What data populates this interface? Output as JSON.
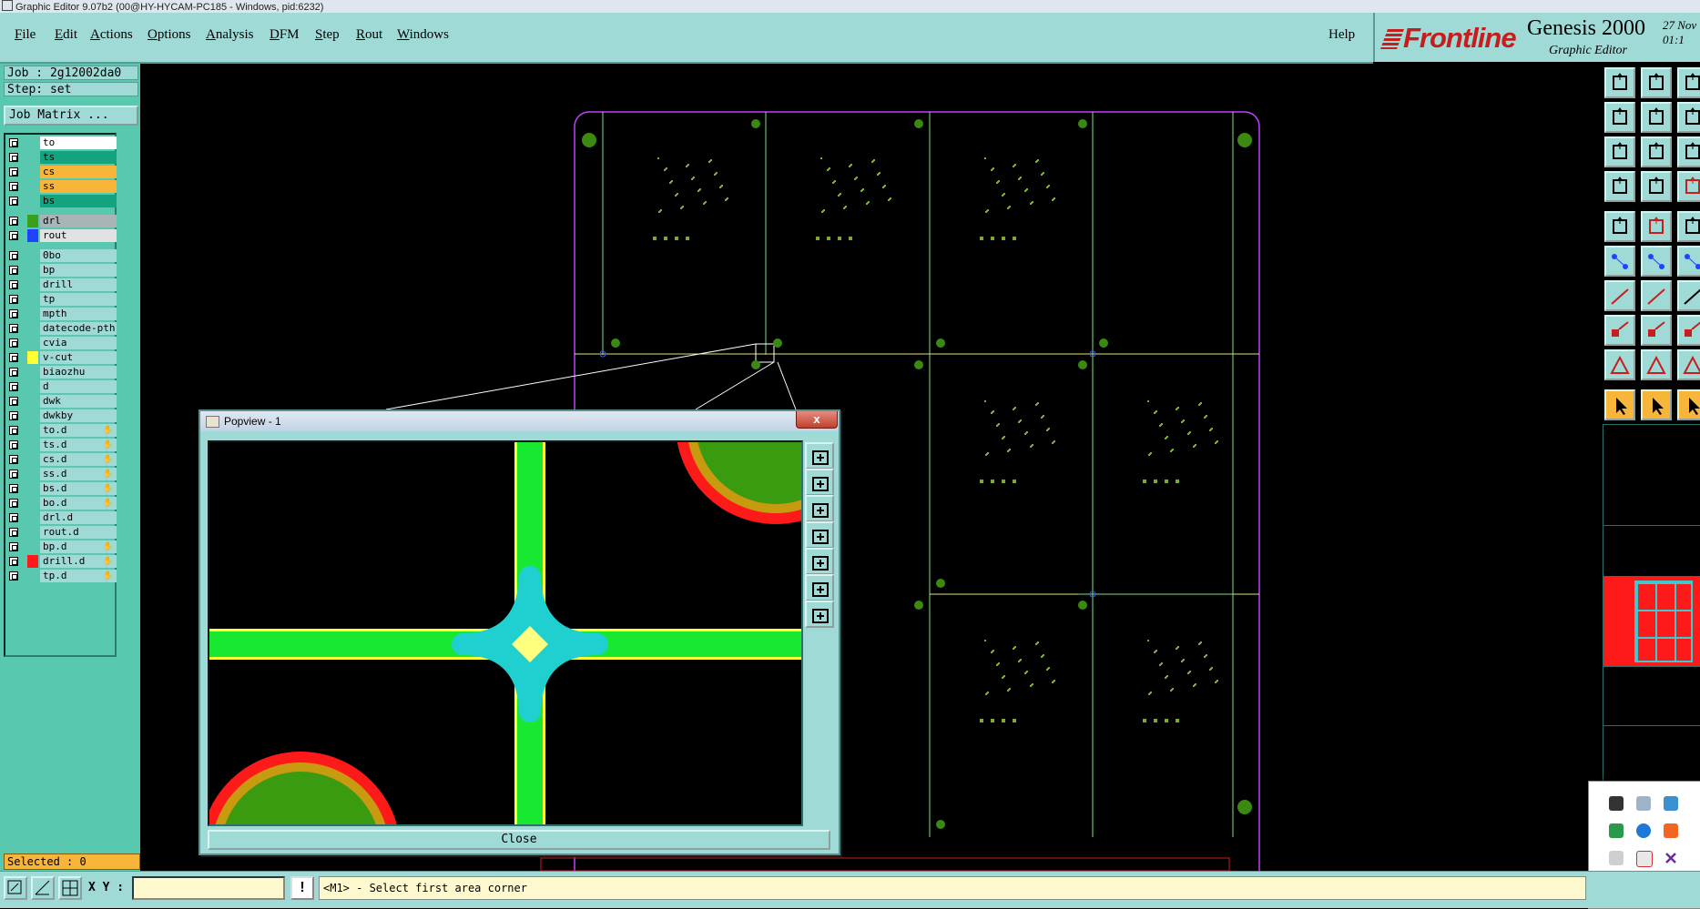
{
  "window": {
    "title": "Graphic Editor 9.07b2 (00@HY-HYCAM-PC185 - Windows, pid:6232)"
  },
  "menubar": {
    "items": [
      {
        "u": "F",
        "rest": "ile"
      },
      {
        "u": "E",
        "rest": "dit"
      },
      {
        "u": "A",
        "rest": "ctions"
      },
      {
        "u": "O",
        "rest": "ptions"
      },
      {
        "u": "A",
        "rest": "nalysis"
      },
      {
        "u": "D",
        "rest": "FM"
      },
      {
        "u": "S",
        "rest": "tep"
      },
      {
        "u": "R",
        "rest": "out"
      },
      {
        "u": "W",
        "rest": "indows"
      }
    ],
    "help": "Help"
  },
  "brand": {
    "logo": "Frontline",
    "product": "Genesis 2000",
    "subtitle": "Graphic Editor",
    "date_line1": "27 Nov",
    "date_line2": "01:1"
  },
  "job": {
    "job_label": "Job : 2g12002da0",
    "step_label": "Step: set",
    "job_matrix": "Job Matrix ..."
  },
  "layers": [
    {
      "name": "to",
      "color": "#ffffff",
      "swatch": "",
      "hand": false
    },
    {
      "name": "ts",
      "color": "#14a37f",
      "swatch": "",
      "hand": false
    },
    {
      "name": "cs",
      "color": "#f7b53a",
      "swatch": "",
      "hand": false
    },
    {
      "name": "ss",
      "color": "#f7b53a",
      "swatch": "",
      "hand": false
    },
    {
      "name": "bs",
      "color": "#14a37f",
      "swatch": "",
      "hand": false
    },
    {
      "name": "drl",
      "color": "#a9b4b6",
      "swatch": "#3aa01a",
      "hand": false
    },
    {
      "name": "rout",
      "color": "#e2e2e2",
      "swatch": "#1e44ff",
      "hand": false
    },
    {
      "name": "0bo",
      "color": "#9fdad7",
      "swatch": "",
      "hand": false
    },
    {
      "name": "bp",
      "color": "#9fdad7",
      "swatch": "",
      "hand": false
    },
    {
      "name": "drill",
      "color": "#9fdad7",
      "swatch": "",
      "hand": false
    },
    {
      "name": "tp",
      "color": "#9fdad7",
      "swatch": "",
      "hand": false
    },
    {
      "name": "mpth",
      "color": "#9fdad7",
      "swatch": "",
      "hand": false
    },
    {
      "name": "datecode-pth",
      "color": "#9fdad7",
      "swatch": "",
      "hand": false
    },
    {
      "name": "cvia",
      "color": "#9fdad7",
      "swatch": "",
      "hand": false
    },
    {
      "name": "v-cut",
      "color": "#9fdad7",
      "swatch": "#ffff33",
      "hand": false
    },
    {
      "name": "biaozhu",
      "color": "#9fdad7",
      "swatch": "",
      "hand": false
    },
    {
      "name": "d",
      "color": "#9fdad7",
      "swatch": "",
      "hand": false
    },
    {
      "name": "dwk",
      "color": "#9fdad7",
      "swatch": "",
      "hand": false
    },
    {
      "name": "dwkby",
      "color": "#9fdad7",
      "swatch": "",
      "hand": false
    },
    {
      "name": "to.d",
      "color": "#9fdad7",
      "swatch": "",
      "hand": true
    },
    {
      "name": "ts.d",
      "color": "#9fdad7",
      "swatch": "",
      "hand": true
    },
    {
      "name": "cs.d",
      "color": "#9fdad7",
      "swatch": "",
      "hand": true
    },
    {
      "name": "ss.d",
      "color": "#9fdad7",
      "swatch": "",
      "hand": true
    },
    {
      "name": "bs.d",
      "color": "#9fdad7",
      "swatch": "",
      "hand": true
    },
    {
      "name": "bo.d",
      "color": "#9fdad7",
      "swatch": "",
      "hand": true
    },
    {
      "name": "drl.d",
      "color": "#9fdad7",
      "swatch": "",
      "hand": false
    },
    {
      "name": "rout.d",
      "color": "#9fdad7",
      "swatch": "",
      "hand": false
    },
    {
      "name": "bp.d",
      "color": "#9fdad7",
      "swatch": "",
      "hand": true
    },
    {
      "name": "drill.d",
      "color": "#9fdad7",
      "swatch": "#ff1a1a",
      "hand": true
    },
    {
      "name": "tp.d",
      "color": "#9fdad7",
      "swatch": "",
      "hand": true
    }
  ],
  "selected": "Selected : 0",
  "bottombar": {
    "xy_label": "X Y :",
    "xy_value": "",
    "msg_button": "!",
    "status": "<M1> - Select first area corner"
  },
  "popview": {
    "title": "Popview - 1",
    "close_x": "x",
    "close_button": "Close"
  },
  "colors": {
    "accent": "#9fdad7",
    "panel": "#58c9ae",
    "orange": "#f7b53a",
    "brand_red": "#c81d1d"
  }
}
